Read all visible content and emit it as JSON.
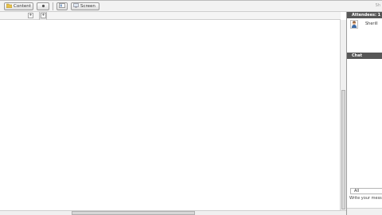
{
  "toolbar": {
    "content_label": "Content",
    "screen_label": "Screen",
    "top_right_text": "Sh"
  },
  "tabs": {
    "add_symbol": "+"
  },
  "panel": {
    "attendees_header": "Attendees: 1",
    "attendee_name": "Sherill",
    "chat_header": "Chat",
    "chat_select_value": "All",
    "chat_input_placeholder": "Write your message"
  },
  "colors": {
    "panel_header_bg": "#575757",
    "toolbar_bg": "#f2f2f2"
  }
}
